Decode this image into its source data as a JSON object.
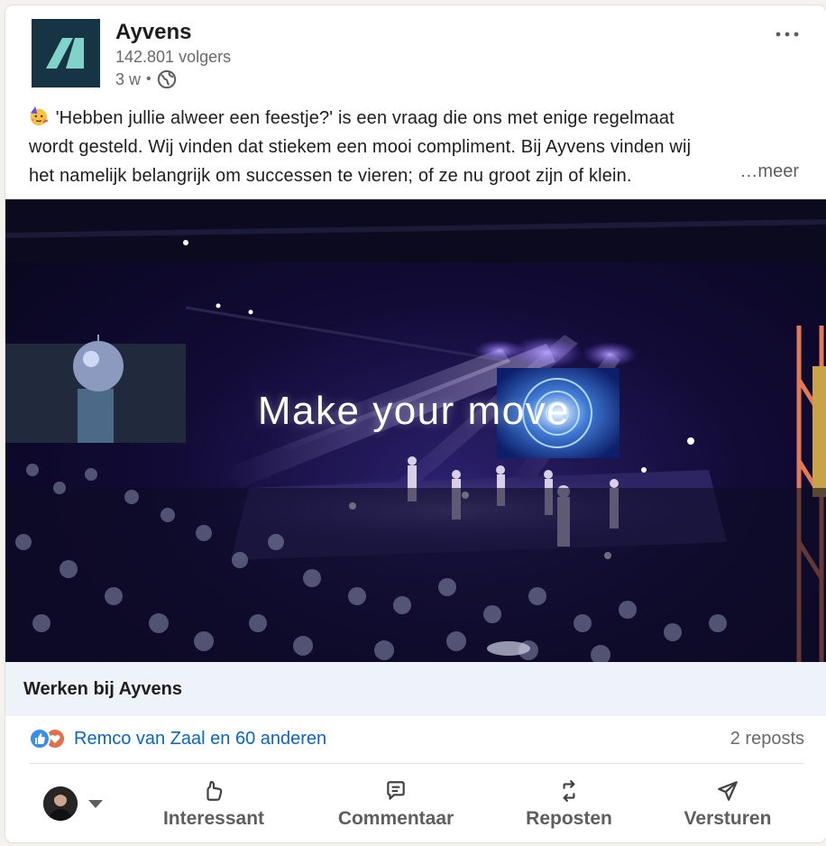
{
  "post": {
    "author": "Ayvens",
    "followers": "142.801 volgers",
    "age": "3 w",
    "separator": "•",
    "visibility_icon": "globe-icon",
    "more_icon": "more-horizontal-icon",
    "text_line1": "'Hebben jullie alweer een feestje?' is een vraag die ons met enige regelmaat",
    "text_line2": "wordt gesteld. Wij vinden dat stiekem een mooi compliment. Bij Ayvens vinden wij",
    "text_line3": "het namelijk belangrijk om successen te vieren; of ze nu groot zijn of klein.",
    "see_more": "…meer",
    "emoji_icon": "party-face-icon"
  },
  "media": {
    "caption": "Make your move",
    "footer_title": "Werken bij Ayvens"
  },
  "social": {
    "reactions_text": "Remco van Zaal en 60 anderen",
    "reaction_icons": [
      "like-icon",
      "love-icon"
    ],
    "reposts": "2 reposts"
  },
  "actions": {
    "like": "Interessant",
    "comment": "Commentaar",
    "repost": "Reposten",
    "send": "Versturen"
  },
  "colors": {
    "logo_bg": "#163443",
    "logo_mark": "#7fd3c8",
    "link": "#0a66c2",
    "muted": "#6a6a6a",
    "media_footer_bg": "#edf3f8"
  }
}
